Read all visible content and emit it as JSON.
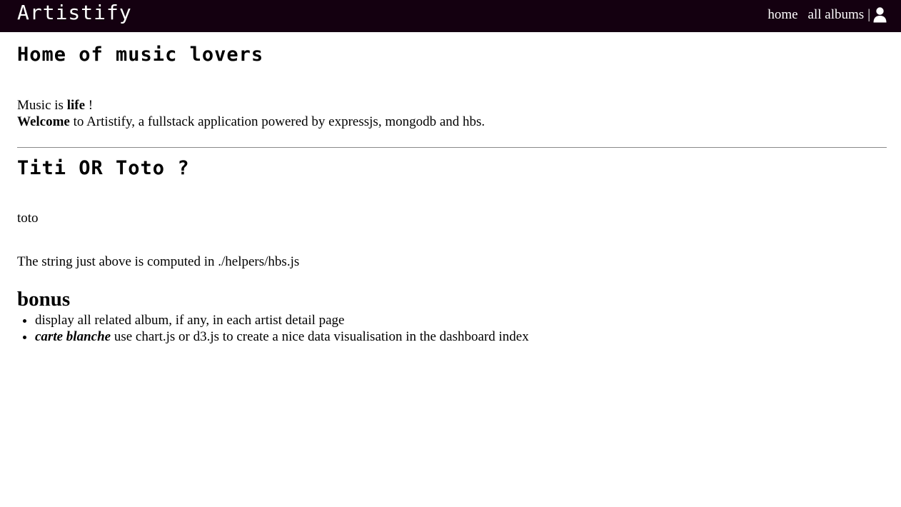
{
  "navbar": {
    "brand": "Artistify",
    "links": {
      "home": "home",
      "all_albums": "all albums"
    },
    "separator": "|",
    "user_icon": "user-icon",
    "background": "#140010"
  },
  "home": {
    "title": "Home of music lovers",
    "intro": {
      "line1_prefix": "Music is ",
      "line1_bold": "life",
      "line1_suffix": " !",
      "line2_bold": "Welcome",
      "line2_rest": " to Artistify, a fullstack application powered by expressjs, mongodb and hbs."
    }
  },
  "quiz": {
    "title": "Titi OR Toto ?",
    "result": "toto",
    "note": "The string just above is computed in ./helpers/hbs.js"
  },
  "bonus": {
    "title": "bonus",
    "items": [
      {
        "emphasis": "",
        "text": "display all related album, if any, in each artist detail page"
      },
      {
        "emphasis": "carte blanche",
        "text": " use chart.js or d3.js to create a nice data visualisation in the dashboard index"
      }
    ]
  }
}
